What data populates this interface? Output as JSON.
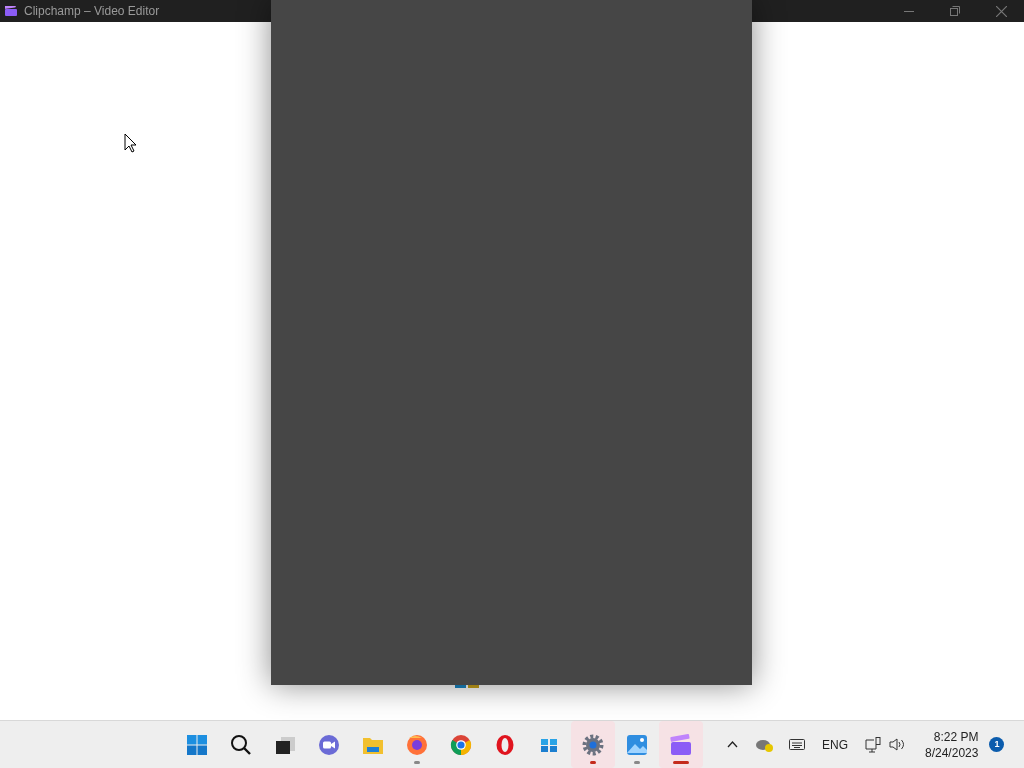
{
  "window": {
    "title": "Clipchamp – Video Editor"
  },
  "taskbar": {
    "apps": [
      {
        "kind": "start",
        "running": false,
        "active": false
      },
      {
        "kind": "search",
        "running": false,
        "active": false
      },
      {
        "kind": "taskview",
        "running": false,
        "active": false
      },
      {
        "kind": "chat",
        "running": false,
        "active": false
      },
      {
        "kind": "files",
        "running": false,
        "active": false
      },
      {
        "kind": "firefox",
        "running": true,
        "active": false
      },
      {
        "kind": "chrome",
        "running": false,
        "active": false
      },
      {
        "kind": "opera",
        "running": false,
        "active": false
      },
      {
        "kind": "store",
        "running": false,
        "active": false
      },
      {
        "kind": "settings",
        "running": true,
        "active": true
      },
      {
        "kind": "photos",
        "running": true,
        "active": false
      },
      {
        "kind": "clipchamp",
        "running": true,
        "active": true
      }
    ]
  },
  "tray": {
    "language": "ENG",
    "time": "8:22 PM",
    "date": "8/24/2023",
    "notifications": "1"
  }
}
